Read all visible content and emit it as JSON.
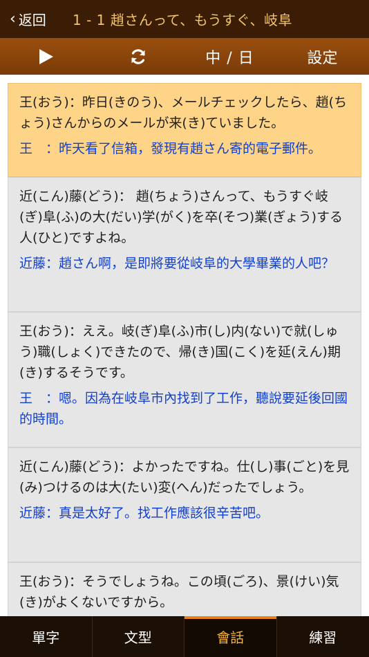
{
  "header": {
    "back_label": "返回",
    "title": "1 - 1 趙さんって、もうすぐ、岐阜"
  },
  "toolbar": {
    "play_icon": "play-icon",
    "repeat_icon": "repeat-icon",
    "lang_label": "中 / 日",
    "settings_label": "設定"
  },
  "dialogue": [
    {
      "jp": "王(おう)：昨日(きのう)、メールチェックしたら、趙(ちょう)さんからのメールが来(き)ていました。",
      "zh": "王　：昨天看了信箱，發現有趙さん寄的電子郵件。",
      "active": true
    },
    {
      "jp": "近(こん)藤(どう)： 趙(ちょう)さんって、もうすぐ岐(ぎ)阜(ふ)の大(だい)学(がく)を卒(そつ)業(ぎょう)する人(ひと)ですよね。",
      "zh": "近藤：趙さん啊，是即將要從岐阜的大學畢業的人吧？",
      "active": false
    },
    {
      "jp": "王(おう)：ええ。岐(ぎ)阜(ふ)市(し)内(ない)で就(しゅう)職(しょく)できたので、帰(き)国(こく)を延(えん)期(き)するそうです。",
      "zh": "王　：嗯。因為在岐阜市內找到了工作，聽說要延後回國的時間。",
      "active": false
    },
    {
      "jp": "近(こん)藤(どう)：よかったですね。仕(し)事(ごと)を見(み)つけるのは大(たい)変(へん)だったでしょう。",
      "zh": "近藤：真是太好了。找工作應該很辛苦吧。",
      "active": false
    },
    {
      "jp": "王(おう)：そうでしょうね。この頃(ごろ)、景(けい)気(き)がよくないですから。",
      "zh": "",
      "active": false
    }
  ],
  "tabs": [
    {
      "label": "單字",
      "active": false
    },
    {
      "label": "文型",
      "active": false
    },
    {
      "label": "會話",
      "active": true
    },
    {
      "label": "練習",
      "active": false
    }
  ],
  "colors": {
    "title_bar": "#3a1d04",
    "toolbar": "#8a4509",
    "title_text": "#f2c468",
    "active_card": "#fdd488",
    "translation": "#1240d0",
    "active_tab": "#f2b33a"
  }
}
